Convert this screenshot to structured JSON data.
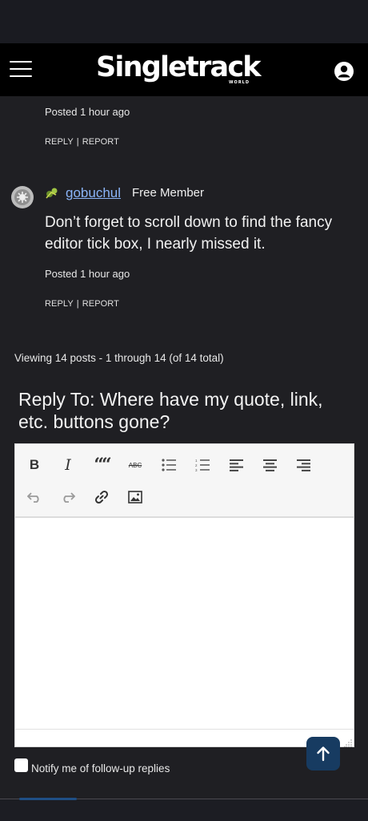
{
  "header": {
    "logo_text": "Singletrack",
    "logo_sub": "WORLD"
  },
  "previous_post": {
    "posted": "Posted 1 hour ago",
    "reply_label": "REPLY",
    "separator": "|",
    "report_label": "REPORT"
  },
  "post": {
    "author": "gobuchul",
    "member_type": "Free Member",
    "text": "Don’t forget to scroll down to find the fancy editor tick box, I nearly missed it.",
    "posted": "Posted 1 hour ago",
    "reply_label": "REPLY",
    "separator": "|",
    "report_label": "REPORT"
  },
  "topic": {
    "viewing": "Viewing 14 posts - 1 through 14 (of 14 total)",
    "reply_title": "Reply To: Where have my quote, link, etc. buttons gone?"
  },
  "editor": {
    "bold": "B",
    "italic": "I",
    "quote": "““",
    "strikethrough": "ABC",
    "toolbar_icons": [
      "bold-icon",
      "italic-icon",
      "blockquote-icon",
      "strikethrough-icon",
      "bullet-list-icon",
      "numbered-list-icon",
      "align-left-icon",
      "align-center-icon",
      "align-right-icon",
      "undo-icon",
      "redo-icon",
      "link-icon",
      "image-icon"
    ]
  },
  "notify": {
    "label": "Notify me of follow-up replies"
  },
  "colors": {
    "background": "#1f1f23",
    "header": "#000000",
    "link": "#8ab4f8",
    "scroll_button": "#173b61"
  }
}
